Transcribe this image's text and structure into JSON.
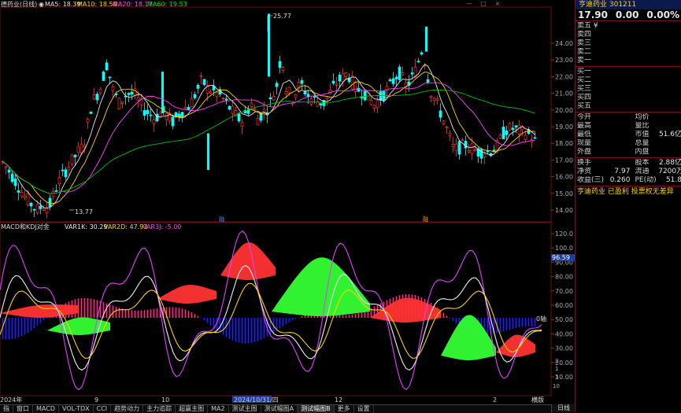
{
  "header": {
    "title": "德药业(日线)",
    "ma_dot": "◉",
    "ma5": "MA5: 18.39",
    "ma10": "MA10: 18.58",
    "ma20": "MA20: 18.17",
    "ma60": "MA60: 19.53",
    "high_label": "25.77",
    "low_label": "13.77",
    "marker1": "融",
    "marker2": "融"
  },
  "price_axis": {
    "ticks": [
      "24.00",
      "23.00",
      "22.00",
      "21.00",
      "20.00",
      "19.00",
      "18.00",
      "17.00",
      "16.00",
      "15.00",
      "14.00"
    ]
  },
  "indicator": {
    "title": "MACD和KDJ对金",
    "var1k": "VAR1K: 30.29",
    "var2d": "VAR2D: 47.93",
    "var3j": "VAR3J: -5.00",
    "axis_ticks": [
      "120.0",
      "100.0",
      "90.00",
      "80.00",
      "70.00",
      "60.00",
      "50.00",
      "40.00",
      "30.00",
      "20.00",
      "10.00"
    ],
    "axis_highlight": "96.59",
    "side_label": "0轴",
    "bottom_small": [
      "10",
      "3",
      "1",
      "2"
    ]
  },
  "dates": [
    "2024年",
    "9",
    "10",
    "2024/10/31/四",
    "12",
    "2"
  ],
  "tabs": [
    "指",
    "窗口",
    "MACD",
    "VOL-TDX",
    "CCI",
    "趋势动力",
    "主力追踪",
    "超赢主图",
    "MA2",
    "测试主图",
    "测试幅图A",
    "测试幅图B",
    "更多",
    "设置"
  ],
  "tabs_active": "测试幅图B",
  "rt_buttons": [
    "横版"
  ],
  "day_button": "日线",
  "top_buttons": [
    "—",
    "□",
    "×"
  ],
  "panel": {
    "ticker": "亨迪药业 301211",
    "price": "17.90",
    "change": "0.00",
    "change_pct": "0.00%",
    "asks": [
      "卖五 ¥",
      "卖四",
      "卖三",
      "卖二",
      "卖一"
    ],
    "bids": [
      "买一",
      "买二",
      "买三",
      "买四",
      "买五"
    ],
    "stats": [
      {
        "l1": "今开",
        "v1": "",
        "l2": "均价",
        "v2": ""
      },
      {
        "l1": "最高",
        "v1": "",
        "l2": "量比",
        "v2": ""
      },
      {
        "l1": "最低",
        "v1": "",
        "l2": "市值",
        "v2": "51.6亿"
      },
      {
        "l1": "现量",
        "v1": "",
        "l2": "总量",
        "v2": ""
      },
      {
        "l1": "外盘",
        "v1": "",
        "l2": "内盘",
        "v2": ""
      }
    ],
    "stats2": [
      {
        "l1": "换手",
        "v1": "",
        "l2": "股本",
        "v2": "2.88亿"
      },
      {
        "l1": "净资",
        "v1": "7.97",
        "l2": "流通",
        "v2": "7200万"
      },
      {
        "l1": "收益(三)",
        "v1": "0.260",
        "l2": "PE(动)",
        "v2": "51.8"
      }
    ],
    "footer": "亨迪药业 已盈利 投票权无差异"
  }
}
